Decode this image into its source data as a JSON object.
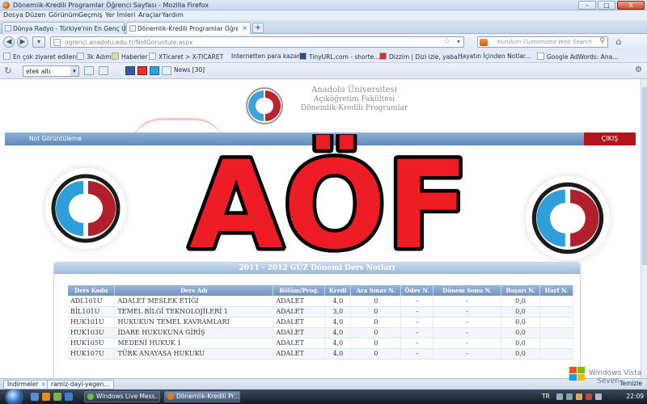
{
  "window": {
    "title": "Dönemlik-Kredili Programlar Öğrenci Sayfası - Mozilla Firefox",
    "minimize": "–",
    "maximize": "□",
    "close": "X"
  },
  "menu": [
    {
      "label": "Dosya"
    },
    {
      "label": "Düzen"
    },
    {
      "label": "Görünüm"
    },
    {
      "label": "Geçmiş"
    },
    {
      "label": "Yer İmleri"
    },
    {
      "label": "Araçlar"
    },
    {
      "label": "Yardım"
    }
  ],
  "tabs": [
    {
      "label": "Dünya Radyo - Türkiye'nin En Genç U..."
    },
    {
      "label": "Dönemlik-Kredili Programlar Öğrenci..."
    }
  ],
  "new_tab": "+",
  "tab_close": "×",
  "nav": {
    "back": "◀",
    "forward": "▶",
    "url": "ogrenci.anadolu.edu.tr/NotGoruntule.aspx",
    "search_placeholder": "Kurulum Customized Web Search"
  },
  "bookmarks": [
    {
      "label": "En çok ziyaret edilenler"
    },
    {
      "label": "3k Adım"
    },
    {
      "label": "Haberler"
    },
    {
      "label": "XTicaret > X-TICARET"
    },
    {
      "label": "Internetten para kazan..."
    },
    {
      "label": "TinyURL.com - shorte..."
    },
    {
      "label": "Dizzim | Dizi izle, yaba..."
    },
    {
      "label": "Hayatın İçinden Notlar..."
    },
    {
      "label": "Google AdWords: Ana..."
    }
  ],
  "toolbar2": {
    "select_value": "etek altı",
    "news": "News [30]"
  },
  "site": {
    "university": "Anadolu Üniversitesi",
    "faculty": "Açıköğretim Fakültesi",
    "program": "Dönemlik-Kredili Programlar",
    "nav_item": "Not Görüntüleme",
    "exit": "ÇIKIŞ",
    "panel_title": "2011 - 2012 GÜZ Dönemi Ders Notları"
  },
  "overlay": {
    "text": "AÖF",
    "fill": "#ee1c24",
    "stroke": "#000000"
  },
  "table": {
    "headers": [
      "Ders Kodu",
      "Ders Adı",
      "Bölüm/Prog.",
      "Kredi",
      "Ara Sınav N.",
      "Ödev N.",
      "Dönem Sonu N.",
      "Başarı N.",
      "Harf N."
    ],
    "rows": [
      [
        "ADL101U",
        "ADALET MESLEK ETİĞİ",
        "ADALET",
        "4,0",
        "0",
        "-",
        "-",
        "0,0",
        ""
      ],
      [
        "BİL101U",
        "TEMEL BİLGİ TEKNOLOJİLERİ 1",
        "ADALET",
        "3,0",
        "0",
        "-",
        "-",
        "0,0",
        ""
      ],
      [
        "HUK101U",
        "HUKUKUN TEMEL KAVRAMLARI",
        "ADALET",
        "4,0",
        "0",
        "-",
        "-",
        "0,0",
        ""
      ],
      [
        "HUK103U",
        "İDARE HUKUKUNA GİRİŞ",
        "ADALET",
        "4,0",
        "0",
        "-",
        "-",
        "0,0",
        ""
      ],
      [
        "HUK105U",
        "MEDENİ HUKUK 1",
        "ADALET",
        "4,0",
        "0",
        "-",
        "-",
        "0,0",
        ""
      ],
      [
        "HUK107U",
        "TÜRK ANAYASA HUKUKU",
        "ADALET",
        "4,0",
        "0",
        "-",
        "-",
        "0,0",
        ""
      ]
    ]
  },
  "statusbar": {
    "tab1": "İndirmeler",
    "tab2": "ramiz-dayi-yegen...",
    "right": "Temizle"
  },
  "vista": {
    "line1": "Windows Vista",
    "line2": "Seven"
  },
  "taskbar": {
    "task1": "Windows Live Mess...",
    "task2": "Dönemlik-Kredili Pr...",
    "lang": "TR",
    "clock": "22:09"
  }
}
